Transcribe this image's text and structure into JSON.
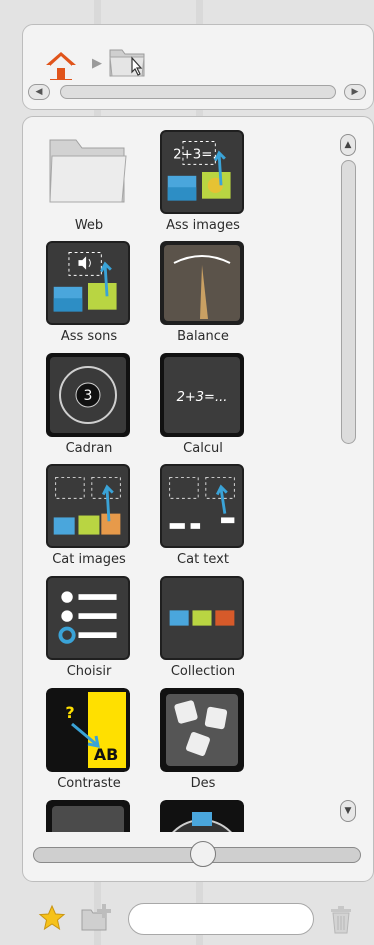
{
  "breadcrumb": {
    "items": [
      {
        "icon": "home-icon",
        "color": "#e0541b"
      },
      {
        "icon": "folder-icon"
      }
    ]
  },
  "grid": {
    "items": [
      {
        "label": "Web",
        "icon": "folder-icon"
      },
      {
        "label": "Ass images",
        "icon": "associate-images-icon"
      },
      {
        "label": "Ass sons",
        "icon": "associate-sounds-icon"
      },
      {
        "label": "Balance",
        "icon": "balance-gauge-icon"
      },
      {
        "label": "Cadran",
        "icon": "dial-icon"
      },
      {
        "label": "Calcul",
        "icon": "calculation-icon",
        "thumb_text": "2+3=..."
      },
      {
        "label": "Cat images",
        "icon": "categorize-images-icon"
      },
      {
        "label": "Cat text",
        "icon": "categorize-text-icon"
      },
      {
        "label": "Choisir",
        "icon": "choose-list-icon"
      },
      {
        "label": "Collection",
        "icon": "collection-icon"
      },
      {
        "label": "Contraste",
        "icon": "contrast-icon",
        "thumb_text": "AB",
        "thumb_q": "?"
      },
      {
        "label": "Des",
        "icon": "dice-icon"
      },
      {
        "label": "",
        "icon": "partial-item-icon"
      },
      {
        "label": "",
        "icon": "partial-item-icon"
      }
    ]
  },
  "zoom": {
    "level": 0.52
  },
  "footer": {
    "search_value": "",
    "search_placeholder": ""
  },
  "colors": {
    "accent_blue": "#3aa3d7",
    "star_yellow": "#f6c21a",
    "contrast_yellow": "#ffe000"
  }
}
